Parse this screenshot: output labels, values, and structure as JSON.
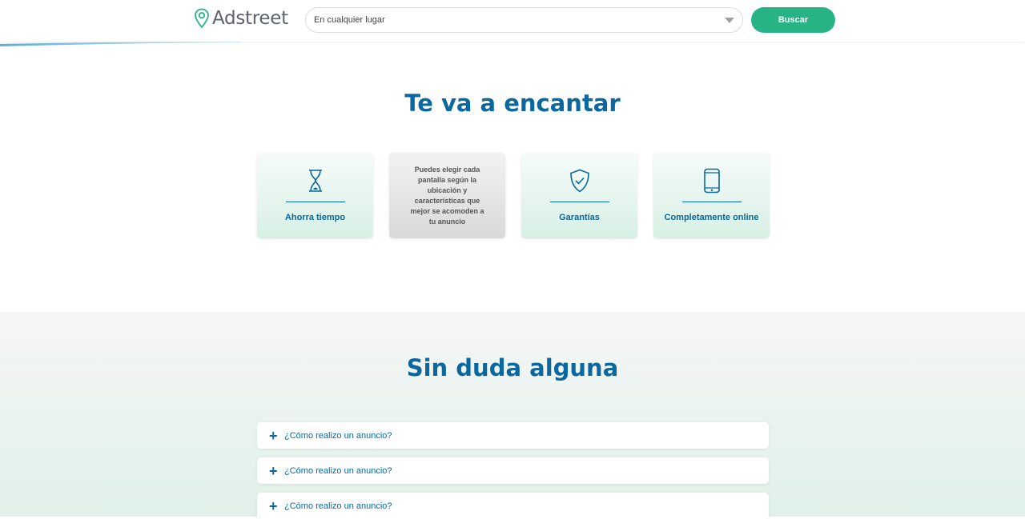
{
  "header": {
    "logo_text": "Adstreet",
    "location_value": "En cualquier lugar",
    "search_label": "Buscar"
  },
  "features": {
    "title": "Te va a encantar",
    "cards": [
      {
        "label": "Ahorra tiempo",
        "icon": "hourglass-icon"
      },
      {
        "label": "",
        "description": "Puedes elegir cada pantalla según la ubicación y características que mejor se acomoden a tu anuncio"
      },
      {
        "label": "Garantías",
        "icon": "shield-check-icon"
      },
      {
        "label": "Completamente online",
        "icon": "smartphone-icon"
      }
    ]
  },
  "faq": {
    "title": "Sin duda alguna",
    "items": [
      {
        "question": "¿Cómo realizo un anuncio?"
      },
      {
        "question": "¿Cómo realizo un anuncio?"
      },
      {
        "question": "¿Cómo realizo un anuncio?"
      }
    ]
  },
  "colors": {
    "brand_blue": "#0b679f",
    "brand_green": "#27b383"
  }
}
